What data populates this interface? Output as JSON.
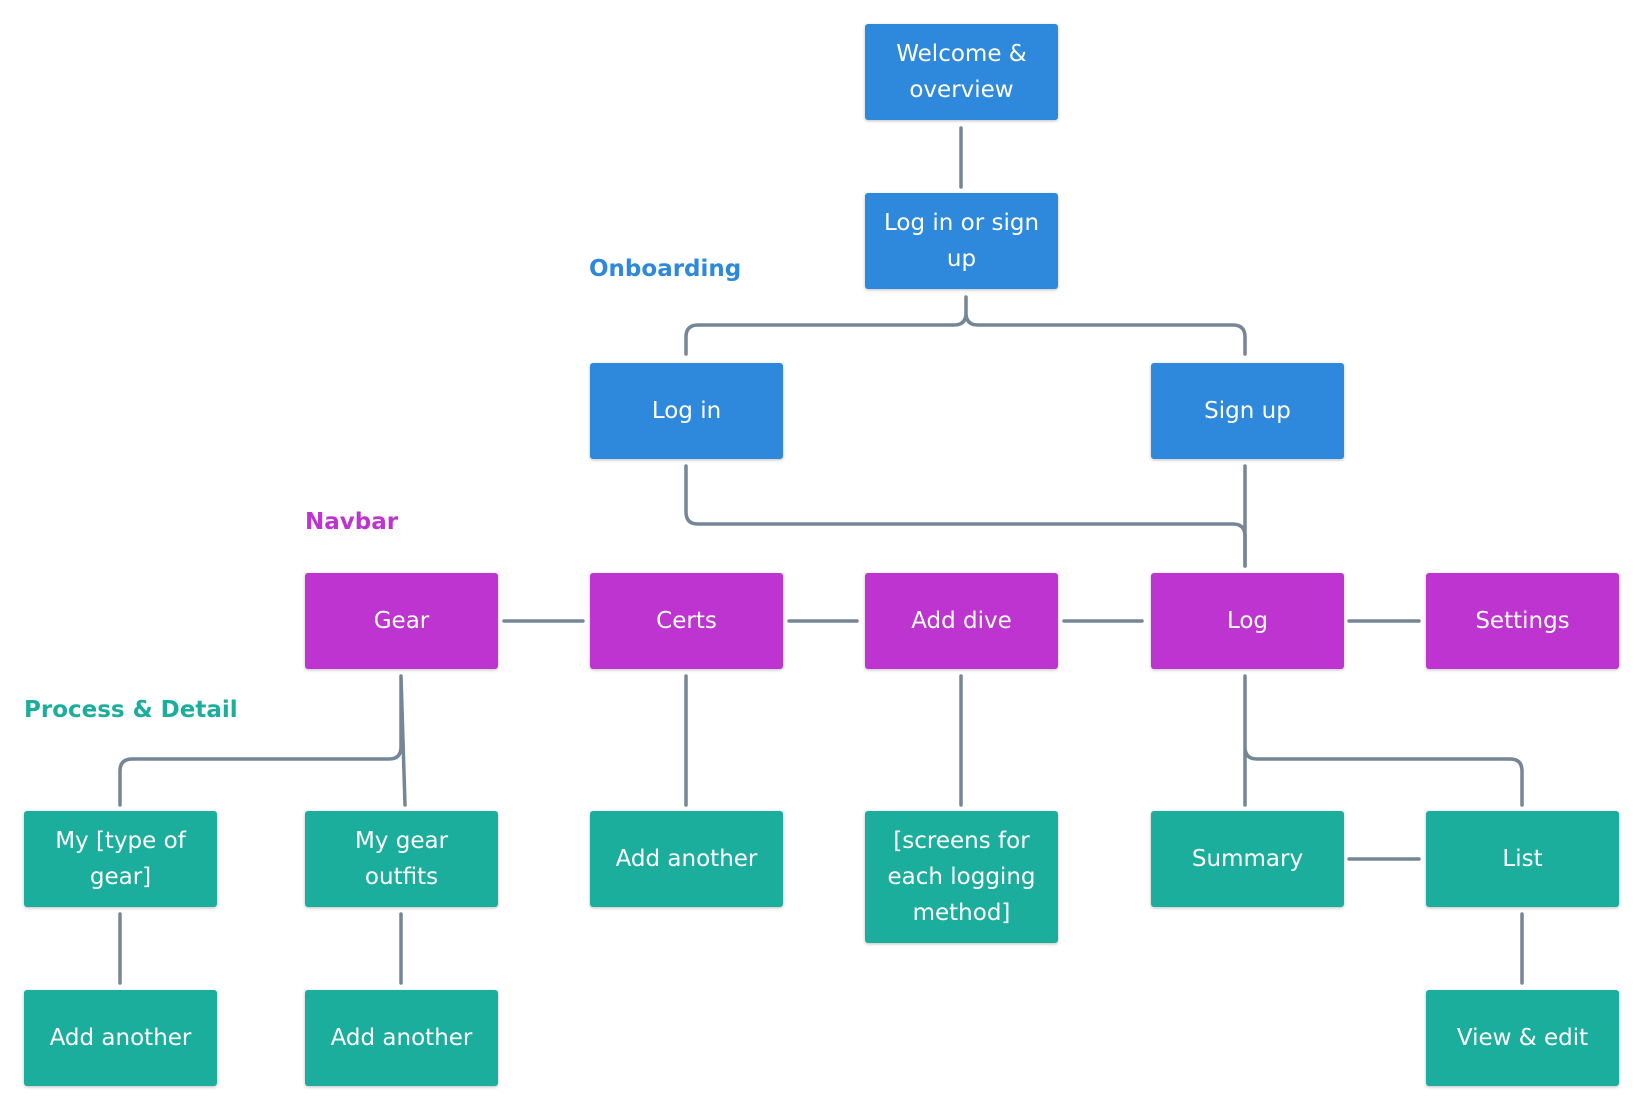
{
  "colors": {
    "onboarding": "#2E88DB",
    "navbar": "#BE34D1",
    "process": "#1BAE9D",
    "connector": "#758696"
  },
  "labels": {
    "onboarding": "Onboarding",
    "navbar": "Navbar",
    "process": "Process & Detail"
  },
  "onboarding": {
    "welcome": "Welcome & overview",
    "login_or_signup": "Log in or sign up",
    "login": "Log in",
    "signup": "Sign up"
  },
  "navbar": {
    "gear": "Gear",
    "certs": "Certs",
    "add_dive": "Add dive",
    "log": "Log",
    "settings": "Settings"
  },
  "process": {
    "my_type_of_gear": "My [type of gear]",
    "my_gear_outfits": "My gear outfits",
    "certs_add_another": "Add another",
    "screens_logging": "[screens for each logging method]",
    "summary": "Summary",
    "list": "List",
    "gear_type_add_another": "Add another",
    "outfits_add_another": "Add another",
    "view_edit": "View & edit"
  }
}
